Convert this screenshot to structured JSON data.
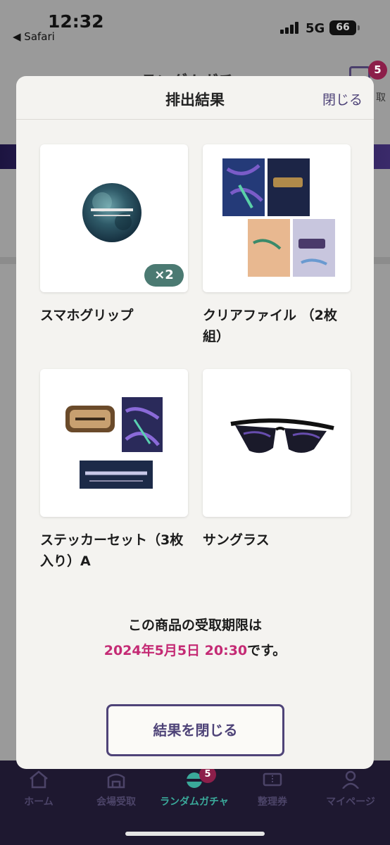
{
  "status_bar": {
    "time": "12:32",
    "back_app": "◀ Safari",
    "network": "5G",
    "battery": "66"
  },
  "background": {
    "title": "ランダムガチャ",
    "cart_badge": "5",
    "cart_label": "取"
  },
  "modal": {
    "title": "排出結果",
    "close_link": "閉じる",
    "items": [
      {
        "name": "スマホグリップ",
        "quantity": "×2",
        "icon": "phone-grip-image"
      },
      {
        "name": "クリアファイル （2枚組）",
        "icon": "clear-file-image"
      },
      {
        "name": "ステッカーセット（3枚入り）A",
        "icon": "sticker-set-image"
      },
      {
        "name": "サングラス",
        "icon": "sunglasses-image"
      }
    ],
    "deadline_prefix": "この商品の受取期限は",
    "deadline_date": "2024年5月5日 20:30",
    "deadline_suffix": "です。",
    "close_button": "結果を閉じる"
  },
  "bottom_nav": [
    {
      "label": "ホーム",
      "icon": "home-icon"
    },
    {
      "label": "会場受取",
      "icon": "venue-icon"
    },
    {
      "label": "ランダムガチャ",
      "icon": "gacha-icon",
      "badge": "5",
      "active": true
    },
    {
      "label": "整理券",
      "icon": "ticket-icon"
    },
    {
      "label": "マイページ",
      "icon": "user-icon"
    }
  ],
  "colors": {
    "accent": "#4e4378",
    "deadline": "#c42a74",
    "nav_active": "#3aa99a",
    "badge": "#8c1f4a",
    "qty_badge": "#4b7a72"
  }
}
